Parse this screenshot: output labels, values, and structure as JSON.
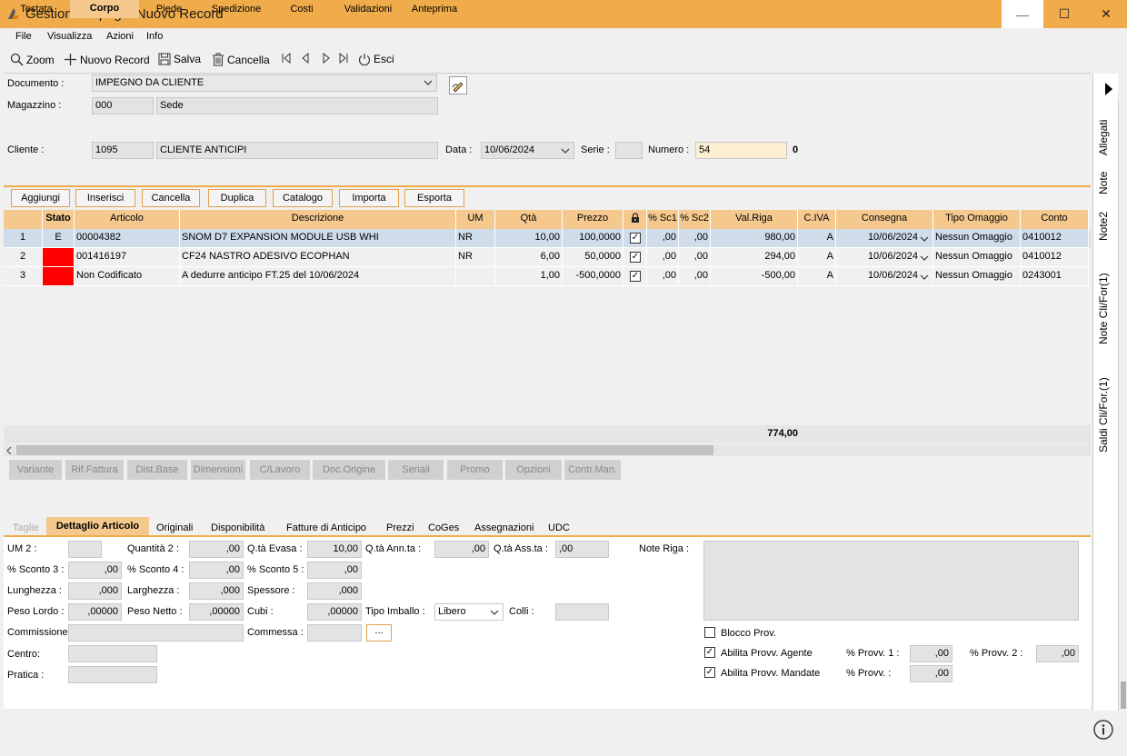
{
  "window": {
    "title": "Gestione Impegni Nuovo Record",
    "min_label": "—",
    "max_label": "☐",
    "close_label": "✕"
  },
  "menu": [
    "File",
    "Visualizza",
    "Azioni",
    "Info"
  ],
  "toolbar": {
    "zoom": "Zoom",
    "nuovo": "Nuovo Record",
    "salva": "Salva",
    "cancella": "Cancella",
    "esci": "Esci"
  },
  "header": {
    "documento_label": "Documento :",
    "documento_value": "IMPEGNO DA CLIENTE",
    "magazzino_label": "Magazzino :",
    "magazzino_code": "000",
    "magazzino_name": "Sede",
    "cliente_label": "Cliente :",
    "cliente_code": "1095",
    "cliente_name": "CLIENTE ANTICIPI",
    "data_label": "Data :",
    "data_value": "10/06/2024",
    "serie_label": "Serie :",
    "serie_value": "",
    "numero_label": "Numero :",
    "numero_value": "54",
    "numero_extra": "0"
  },
  "tabs": [
    "Testata",
    "Corpo",
    "Piede",
    "Spedizione",
    "Costi",
    "Validazioni",
    "Anteprima"
  ],
  "actions": [
    "Aggiungi",
    "Inserisci",
    "Cancella",
    "Duplica",
    "Catalogo",
    "Importa",
    "Esporta"
  ],
  "grid": {
    "headers": [
      "",
      "Stato",
      "Articolo",
      "Descrizione",
      "UM",
      "Qtà",
      "Prezzo",
      "",
      "% Sc1",
      "% Sc2",
      "Val.Riga",
      "C.IVA",
      "Consegna",
      "Tipo Omaggio",
      "Conto"
    ],
    "rows": [
      {
        "n": "1",
        "stato": "E",
        "articolo": "00004382",
        "descrizione": "SNOM D7 EXPANSION MODULE USB WHI",
        "um": "NR",
        "qta": "10,00",
        "prezzo": "100,0000",
        "sc1": ",00",
        "sc2": ",00",
        "valriga": "980,00",
        "civa": "A",
        "consegna": "10/06/2024",
        "omaggio": "Nessun Omaggio",
        "conto": "0410012"
      },
      {
        "n": "2",
        "stato": "",
        "articolo": "001416197",
        "descrizione": "CF24 NASTRO ADESIVO ECOPHAN",
        "um": "NR",
        "qta": "6,00",
        "prezzo": "50,0000",
        "sc1": ",00",
        "sc2": ",00",
        "valriga": "294,00",
        "civa": "A",
        "consegna": "10/06/2024",
        "omaggio": "Nessun Omaggio",
        "conto": "0410012"
      },
      {
        "n": "3",
        "stato": "",
        "articolo": "Non Codificato",
        "descrizione": "A dedurre anticipo FT.25 del 10/06/2024",
        "um": "",
        "qta": "1,00",
        "prezzo": "-500,0000",
        "sc1": ",00",
        "sc2": ",00",
        "valriga": "-500,00",
        "civa": "A",
        "consegna": "10/06/2024",
        "omaggio": "Nessun Omaggio",
        "conto": "0243001"
      }
    ],
    "total": "774,00"
  },
  "disabled_buttons": [
    "Variante",
    "Rif.Fattura",
    "Dist.Base",
    "Dimensioni",
    "C/Lavoro",
    "Doc.Origine",
    "Seriali",
    "Promo",
    "Opzioni",
    "Contr.Man."
  ],
  "bottom_tabs": [
    "Taglie",
    "Dettaglio Articolo",
    "Originali",
    "Disponibilità",
    "Fatture di Anticipo",
    "Prezzi",
    "CoGes",
    "Assegnazioni",
    "UDC"
  ],
  "detail": {
    "um2_label": "UM 2 :",
    "um2": "",
    "quantita2_label": "Quantità 2 :",
    "quantita2": ",00",
    "qta_evasa_label": "Q.tà Evasa :",
    "qta_evasa": "10,00",
    "qta_annta_label": "Q.tà Ann.ta :",
    "qta_annta": ",00",
    "qta_assta_label": "Q.tà Ass.ta :",
    "qta_assta": ",00",
    "note_riga_label": "Note Riga :",
    "sc3_label": "% Sconto 3 :",
    "sc3": ",00",
    "sc4_label": "% Sconto 4 :",
    "sc4": ",00",
    "sc5_label": "% Sconto 5 :",
    "sc5": ",00",
    "lunghezza_label": "Lunghezza :",
    "lunghezza": ",000",
    "larghezza_label": "Larghezza :",
    "larghezza": ",000",
    "spessore_label": "Spessore :",
    "spessore": ",000",
    "peso_lordo_label": "Peso Lordo :",
    "peso_lordo": ",00000",
    "peso_netto_label": "Peso Netto :",
    "peso_netto": ",00000",
    "cubi_label": "Cubi :",
    "cubi": ",00000",
    "tipo_imballo_label": "Tipo Imballo :",
    "tipo_imballo": "Libero",
    "colli_label": "Colli :",
    "colli": "",
    "commissione_label": "Commissione:",
    "commissione": "",
    "commessa_label": "Commessa :",
    "commessa": "",
    "commessa_btn": "...",
    "centro_label": "Centro:",
    "centro": "",
    "pratica_label": "Pratica :",
    "pratica": "",
    "blocco_prov_label": "Blocco Prov.",
    "abilita_agente_label": "Abilita Provv. Agente",
    "abilita_mandate_label": "Abilita Provv. Mandate",
    "provv1_label": "% Provv. 1 :",
    "provv1": ",00",
    "provv2_label": "% Provv. 2 :",
    "provv2": ",00",
    "provv_label": "% Provv.  :",
    "provv": ",00"
  },
  "side_tabs": [
    "Allegati",
    "Note",
    "Note2",
    "Note Cli/For(1)",
    "Saldi Cli/For.(1)"
  ],
  "colors": {
    "accent": "#f0ac4a",
    "header": "#f5c98e",
    "selected_row": "#cfdcea",
    "status_red": "#ff0000"
  }
}
